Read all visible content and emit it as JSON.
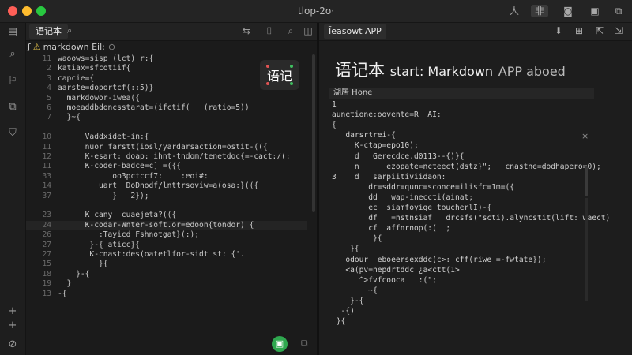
{
  "window": {
    "title": "tlop-2o·"
  },
  "titlebar_icons": [
    "person-icon",
    "lines-icon",
    "save-icon",
    "window-icon",
    "share-icon"
  ],
  "titlebar_glyphs": [
    "人",
    "非",
    "◙",
    "▣",
    "⧉"
  ],
  "activity_icons": [
    "notes-icon",
    "search-icon",
    "puzzle-icon",
    "copy-icon",
    "shield-icon"
  ],
  "activity_glyphs": [
    "▤",
    "⌕",
    "⚐",
    "⧉",
    "⛉"
  ],
  "editor": {
    "tab_label": "语记本",
    "search_glyph": "⌕",
    "toolbar_glyphs": [
      "⇆",
      "⌷",
      "⌕",
      "◫"
    ],
    "breadcrumb": {
      "prefix": "ʃ",
      "warn": "⚠",
      "file": "markdown Eil:",
      "close": "⊖"
    },
    "badge_text": "语记",
    "lines": [
      {
        "n": "11",
        "t": "waoows=sisp (lct) r:{"
      },
      {
        "n": "2",
        "t": "katiax=sfcotiif{"
      },
      {
        "n": "3",
        "t": "capcie={"
      },
      {
        "n": "4",
        "t": "aarste=doportcf(::5)}"
      },
      {
        "n": "5",
        "t": "  markdowor-iwea({"
      },
      {
        "n": "6",
        "t": "  moeaddbdoncsstarat=(ifctif(   (ratio=5))"
      },
      {
        "n": "7",
        "t": "  }~{"
      },
      {
        "n": "10",
        "t": "      Vaddxidet-in:{"
      },
      {
        "n": "11",
        "t": "      nuor farstt(iosl/yardarsaction=ostit-(({"
      },
      {
        "n": "12",
        "t": "      K-esart: doap: ihnt-tndom/tenetdoc{=-cact:/(:"
      },
      {
        "n": "11",
        "t": "      K-coder-badce=c]_=({{"
      },
      {
        "n": "33",
        "t": "            oo3pctccf7:    :eoi#:"
      },
      {
        "n": "14",
        "t": "         uart  DoDnodf/lnttrsoviw=a(osa:}(({"
      },
      {
        "n": "37",
        "t": "            }   2});"
      },
      {
        "n": "23",
        "t": "      K cany  cuaejeta?(({"
      },
      {
        "n": "24",
        "t": "      K-codar-Wnter-soft.or=edoon{tondor) {"
      },
      {
        "n": "26",
        "t": "         :Tayicd Fshnotgat}(:);"
      },
      {
        "n": "27",
        "t": "       }-{ aticc}{"
      },
      {
        "n": "27",
        "t": "       K-cnast:des(oatetlfor-sidt st: {'."
      },
      {
        "n": "15",
        "t": "         }{"
      },
      {
        "n": "18",
        "t": "    }-{"
      },
      {
        "n": "19",
        "t": "  }"
      },
      {
        "n": "13",
        "t": "-{"
      }
    ]
  },
  "preview": {
    "tab_label": "Ĩeasowt APP",
    "toolbar_glyphs": [
      "⬇",
      "⊞",
      "⇱",
      "⇲"
    ],
    "heading_cn": "语记本",
    "heading_sub": "start: Markdown",
    "heading_faint": "APP aboed",
    "bar_label": "湖居 Hone",
    "bar_close": "×",
    "lines": [
      {
        "t": "1",
        "i": 0
      },
      {
        "t": "aunetione:oovente=R  AI:",
        "i": 0
      },
      {
        "t": "{",
        "i": 0
      },
      {
        "t": "   darsrtrei-{",
        "i": 0
      },
      {
        "t": "     K-ctap=epo10);",
        "i": 0
      },
      {
        "t": "     d   Gerecdce.d0113--{)}{",
        "i": 0
      },
      {
        "t": "     n      ezopate=ncteect(dstz}\";   cnastne=dodhapero=0);",
        "i": 0
      },
      {
        "t": "3    d   sarpiitiviidaon:",
        "i": 0
      },
      {
        "t": "        dr=sddr=qunc=sconce=ilisfc=1m=({",
        "i": 0
      },
      {
        "t": "        dd   wap-ineccti(ainat;",
        "i": 0
      },
      {
        "t": "        ec  siamfoyige toucherlI)-{",
        "i": 0
      },
      {
        "t": "        df   =nstnsiaf   drcsfs(\"scti).alyncstit(lift: waect)",
        "i": 0
      },
      {
        "t": "        cf  affnrnop(:(  ;",
        "i": 0
      },
      {
        "t": "         }{",
        "i": 0
      },
      {
        "t": "    }{",
        "i": 0
      },
      {
        "t": "   odour  eboeersexddc(c>: cff(riwe =-fwtate});",
        "i": 0
      },
      {
        "t": "   <a(pv=nepdrtddc ¿a<ctt(1>",
        "i": 0
      },
      {
        "t": "      ^>fvfcooca   :(\";",
        "i": 0
      },
      {
        "t": "        ~{",
        "i": 0
      },
      {
        "t": "    }-{",
        "i": 0
      },
      {
        "t": "  -{)",
        "i": 0
      },
      {
        "t": " }{",
        "i": 0
      }
    ]
  },
  "bottom": {
    "fab_glyph": "▣",
    "left_glyphs": [
      "+",
      "+",
      "⊘"
    ],
    "copy_glyph": "⧉"
  }
}
